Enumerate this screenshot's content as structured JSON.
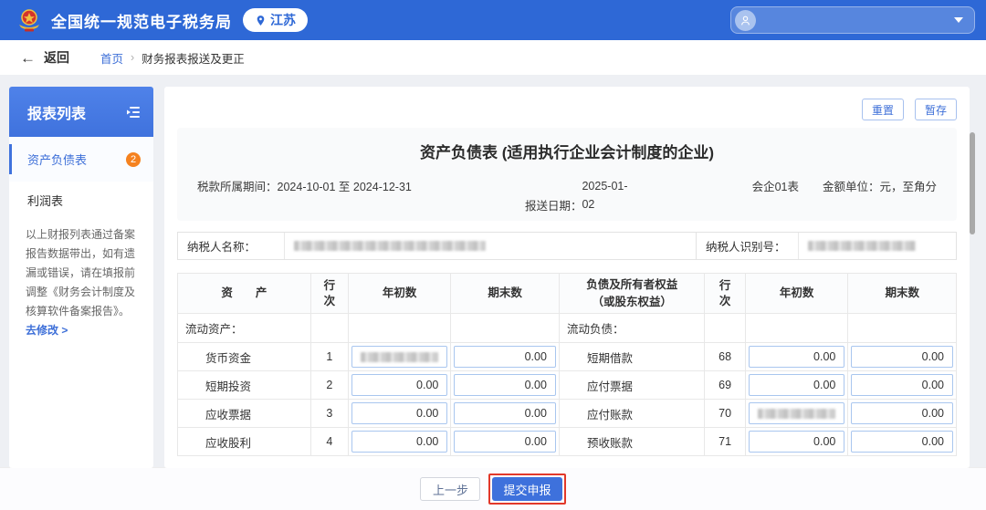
{
  "header": {
    "app_title": "全国统一规范电子税务局",
    "region": "江苏"
  },
  "breadcrumb": {
    "back_label": "返回",
    "home": "首页",
    "separator": "›",
    "current": "财务报表报送及更正"
  },
  "sidebar": {
    "title": "报表列表",
    "items": [
      {
        "label": "资产负债表",
        "badge": "2",
        "active": true
      },
      {
        "label": "利润表",
        "active": false
      }
    ],
    "note": "以上财报列表通过备案报告数据带出，如有遗漏或错误，请在填报前调整《财务会计制度及核算软件备案报告》。",
    "note_link": "去修改 >"
  },
  "toolbar": {
    "reset_label": "重置",
    "hold_label": "暂存"
  },
  "form": {
    "title": "资产负债表 (适用执行企业会计制度的企业)",
    "period_label": "税款所属期间：",
    "period_value": "2024-10-01 至 2024-12-31",
    "report_date_label": "报送日期：",
    "report_date_value": "2025-01-02",
    "form_code": "会企01表",
    "unit_text": "金额单位：元，至角分",
    "taxpayer_name_label": "纳税人名称：",
    "taxpayer_name_redacted": true,
    "taxpayer_id_label": "纳税人识别号：",
    "taxpayer_id_redacted": true
  },
  "table": {
    "headers": {
      "asset": "资　　产",
      "row_no": "行次",
      "opening": "年初数",
      "closing": "期末数",
      "liability": "负债及所有者权益\n（或股东权益）"
    },
    "section_row": {
      "asset": "流动资产：",
      "liability": "流动负债："
    },
    "rows": [
      {
        "asset": "货币资金",
        "asset_no": "1",
        "asset_open": null,
        "asset_open_redacted": true,
        "asset_close": "0.00",
        "liab": "短期借款",
        "liab_no": "68",
        "liab_open": "0.00",
        "liab_close": "0.00"
      },
      {
        "asset": "短期投资",
        "asset_no": "2",
        "asset_open": "0.00",
        "asset_close": "0.00",
        "liab": "应付票据",
        "liab_no": "69",
        "liab_open": "0.00",
        "liab_close": "0.00"
      },
      {
        "asset": "应收票据",
        "asset_no": "3",
        "asset_open": "0.00",
        "asset_close": "0.00",
        "liab": "应付账款",
        "liab_no": "70",
        "liab_open": null,
        "liab_open_redacted": true,
        "liab_close": "0.00"
      },
      {
        "asset": "应收股利",
        "asset_no": "4",
        "asset_open": "0.00",
        "asset_close": "0.00",
        "liab": "预收账款",
        "liab_no": "71",
        "liab_open": "0.00",
        "liab_close": "0.00"
      }
    ]
  },
  "footer": {
    "prev_label": "上一步",
    "submit_label": "提交申报"
  },
  "colors": {
    "header_blue": "#2e68d6",
    "primary_blue": "#3d6fd8",
    "badge_orange": "#f5821f",
    "annotation_red": "#e2382a",
    "input_border": "#a9c6ef"
  }
}
